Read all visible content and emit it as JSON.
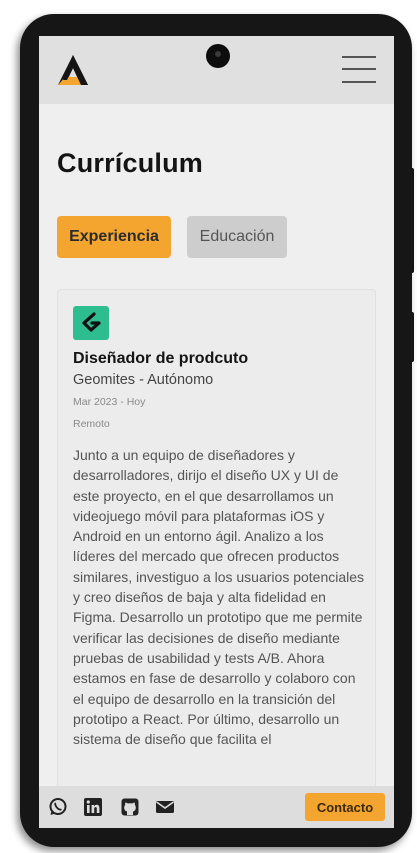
{
  "header": {
    "logo_icon": "triangle-a-logo",
    "menu_icon": "hamburger-icon"
  },
  "page": {
    "title": "Currículum"
  },
  "tabs": [
    {
      "label": "Experiencia",
      "active": true
    },
    {
      "label": "Educación",
      "active": false
    }
  ],
  "experience": {
    "icon": "geomites-logo",
    "title": "Diseñador de prodcuto",
    "company": "Geomites - Autónomo",
    "dates": "Mar 2023 - Hoy",
    "location": "Remoto",
    "description": "Junto a un equipo de diseñadores y desarrolladores, dirijo el diseño UX y UI de este proyecto, en el que desarrollamos un videojuego móvil para plataformas iOS y Android en un entorno ágil. Analizo a los líderes del mercado que ofrecen productos similares, investiguo a los usuarios potenciales y creo diseños de baja y alta fidelidad en Figma. Desarrollo un prototipo que me permite verificar las decisiones de diseño mediante pruebas de usabilidad y tests A/B. Ahora estamos en fase de desarrollo y colaboro con el equipo de desarrollo en la transición del prototipo a React. Por último, desarrollo un sistema de diseño que facilita el"
  },
  "footer": {
    "social_icons": [
      "whatsapp-icon",
      "linkedin-icon",
      "github-icon",
      "mail-icon"
    ],
    "contact_label": "Contacto"
  },
  "colors": {
    "accent": "#f4a52f",
    "company_icon": "#2ebd8e",
    "screen_bg": "#efefef",
    "header_bg": "#e0e0e0"
  }
}
